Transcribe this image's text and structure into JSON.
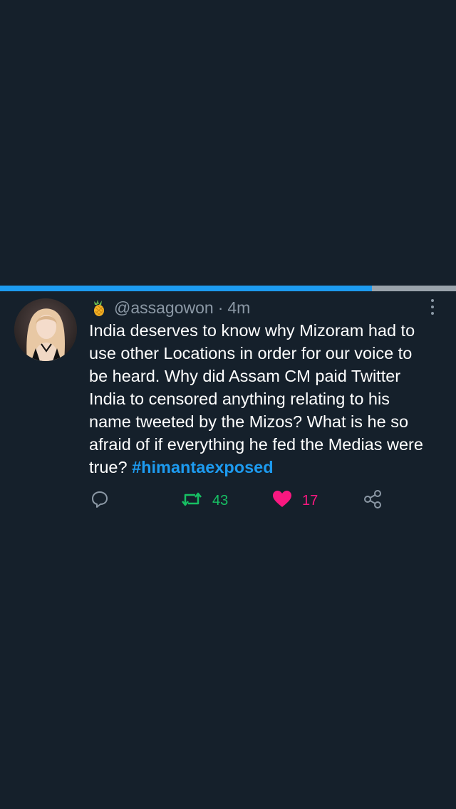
{
  "story_progress": 0.815,
  "colors": {
    "background": "#15202b",
    "accent": "#1d9bf0",
    "retweet": "#17bf63",
    "like": "#f91880",
    "muted": "#8b98a5"
  },
  "tweet": {
    "emoji_icon": "pineapple-icon",
    "handle": "@assagowon",
    "separator": "·",
    "time": "4m",
    "text": "India deserves to know why Mizoram had to\nuse other Locations in order for our voice to\nbe heard. Why did Assam CM paid Twitter\nIndia to censored anything relating to his\nname tweeted by the Mizos? What is he so\nafraid of if everything he fed the Medias were\ntrue? ",
    "hashtag": "#himantaexposed"
  },
  "actions": {
    "reply_icon": "reply-icon",
    "retweet_icon": "retweet-icon",
    "retweet_count": "43",
    "like_icon": "heart-icon",
    "like_count": "17",
    "share_icon": "share-icon"
  }
}
